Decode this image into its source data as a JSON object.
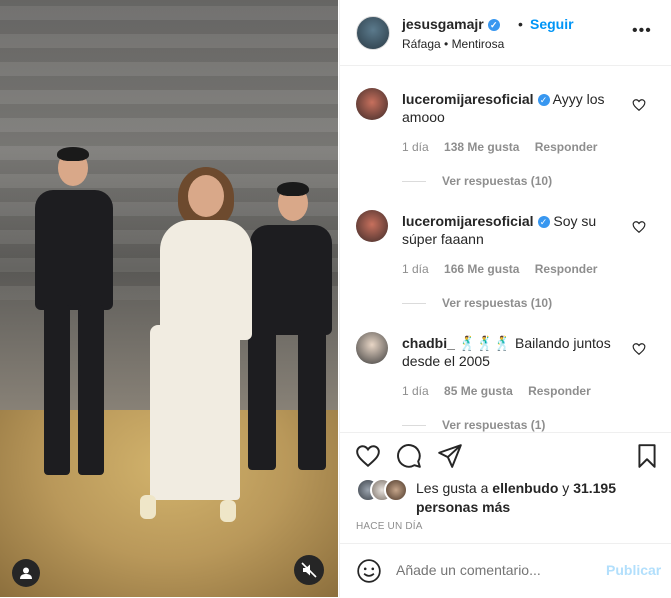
{
  "header": {
    "username": "jesusgamajr",
    "follow_label": "Seguir",
    "dot": "•",
    "subtitle": "Ráfaga • Mentirosa",
    "more": "•••"
  },
  "comments": [
    {
      "username": "luceromijaresoficial",
      "text": "Ayyy los amooo",
      "time": "1 día",
      "likes": "138 Me gusta",
      "reply_label": "Responder",
      "view_replies": "Ver respuestas (10)"
    },
    {
      "username": "luceromijaresoficial",
      "text": "Soy su súper faaann",
      "time": "1 día",
      "likes": "166 Me gusta",
      "reply_label": "Responder",
      "view_replies": "Ver respuestas (10)"
    },
    {
      "username": "chadbi_",
      "text": "Bailando juntos desde el 2005",
      "emoji": "🕺🕺🕺",
      "time": "1 día",
      "likes": "85 Me gusta",
      "reply_label": "Responder",
      "view_replies": "Ver respuestas (1)"
    }
  ],
  "likes": {
    "prefix": "Les gusta a",
    "user": "ellenbudo",
    "connector": "y",
    "others": "31.195 personas más"
  },
  "time_ago": "HACE UN DÍA",
  "comment_box": {
    "placeholder": "Añade un comentario...",
    "publish_label": "Publicar"
  },
  "colors": {
    "accent": "#0095f6",
    "verified": "#3897f0",
    "muted": "#8e8e8e",
    "publish_disabled": "#b2dffc"
  }
}
